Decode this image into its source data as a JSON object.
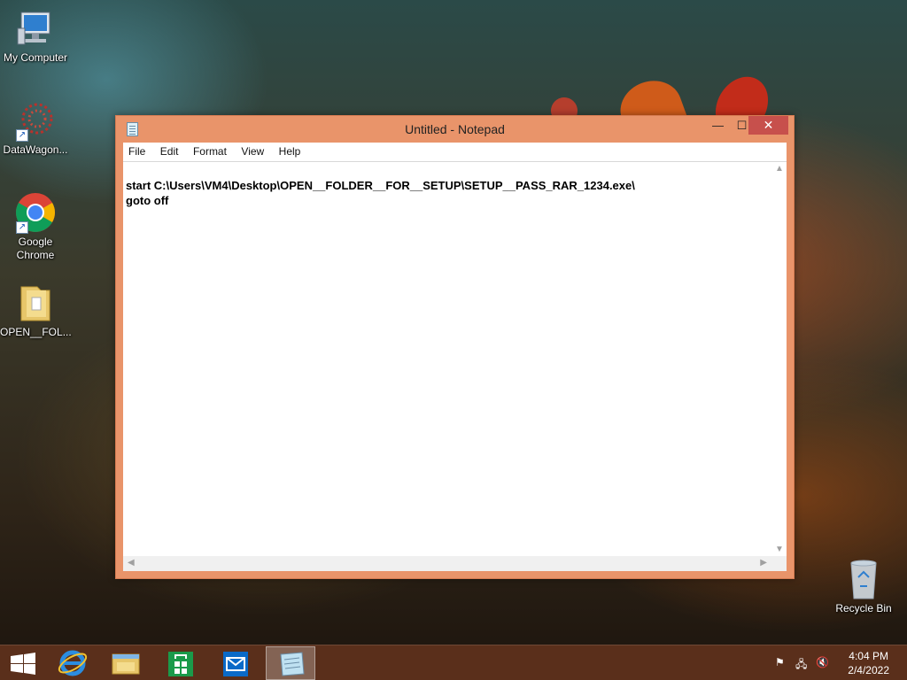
{
  "desktop": {
    "icons": [
      {
        "label": "My Computer"
      },
      {
        "label": "DataWagon..."
      },
      {
        "label": "Google Chrome"
      },
      {
        "label": "OPEN__FOL..."
      },
      {
        "label": "Recycle Bin"
      }
    ]
  },
  "window": {
    "title": "Untitled - Notepad",
    "buttons": {
      "minimize": "—",
      "maximize": "☐",
      "close": "✕"
    },
    "menu": [
      "File",
      "Edit",
      "Format",
      "View",
      "Help"
    ],
    "content": {
      "line1": "start C:\\Users\\VM4\\Desktop\\OPEN__FOLDER__FOR__SETUP\\SETUP__PASS_RAR_1234.exe\\",
      "line2": "goto off"
    }
  },
  "taskbar": {
    "buttons": [
      "start-icon",
      "internet-explorer-icon",
      "file-explorer-icon",
      "store-icon",
      "mail-icon",
      "notepad-icon"
    ],
    "clock": {
      "time": "4:04 PM",
      "date": "2/4/2022"
    }
  },
  "colors": {
    "titlebar": "#e9946a",
    "close": "#c7504c",
    "taskbar": "#5f321c"
  }
}
